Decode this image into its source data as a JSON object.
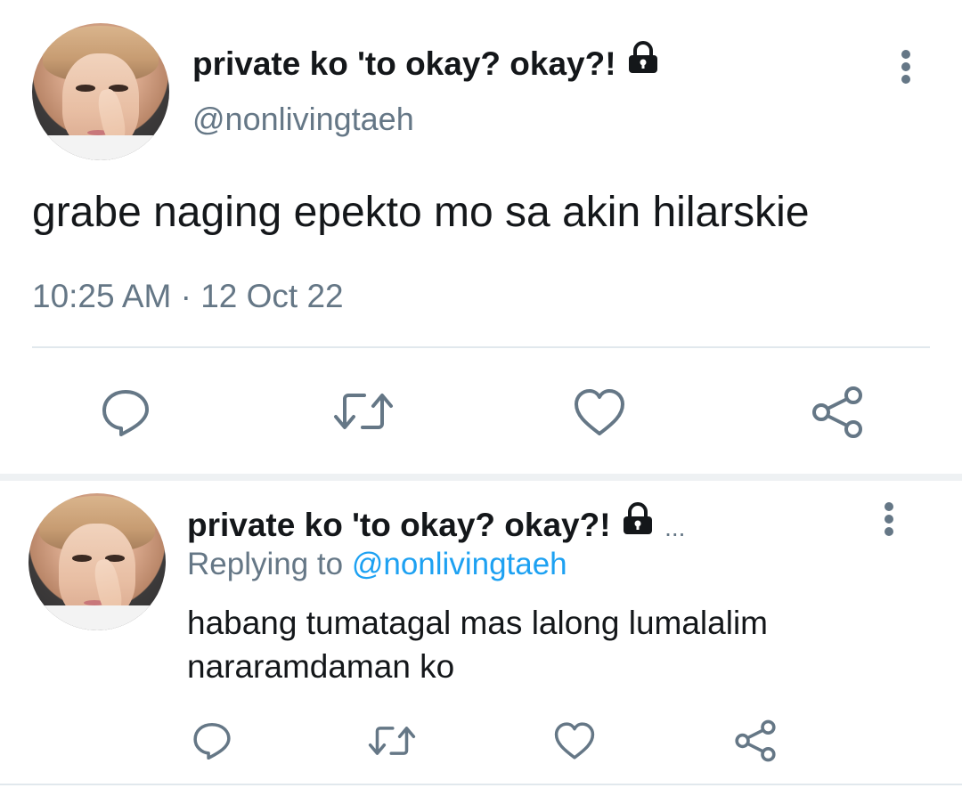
{
  "main_tweet": {
    "display_name": "private ko 'to okay? okay?!",
    "handle": "@nonlivingtaeh",
    "text": "grabe naging epekto mo sa akin hilarskie",
    "timestamp": "10:25 AM · 12 Oct 22",
    "icons": {
      "lock": "lock-icon",
      "more": "more-vertical-icon",
      "reply": "reply-icon",
      "retweet": "retweet-icon",
      "like": "heart-icon",
      "share": "share-icon"
    }
  },
  "reply_tweet": {
    "display_name": "private ko 'to okay? okay?!",
    "truncation": "...",
    "replying_label": "Replying to",
    "replying_handle": "@nonlivingtaeh",
    "text_line_1": "habang tumatagal mas lalong lumalalim",
    "text_line_2": "nararamdaman ko"
  },
  "colors": {
    "text": "#14171a",
    "secondary": "#657786",
    "link": "#1da1f2",
    "divider": "#e1e8ed",
    "background": "#ffffff"
  }
}
